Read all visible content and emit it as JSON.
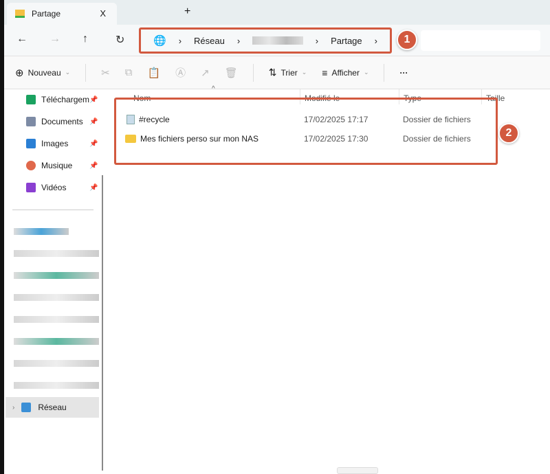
{
  "tab": {
    "title": "Partage",
    "close": "X",
    "new": "+"
  },
  "nav": {
    "back": "←",
    "forward": "→",
    "up": "↑",
    "refresh": "↻"
  },
  "breadcrumb": {
    "items": [
      "Réseau",
      "Partage"
    ],
    "sep": "›"
  },
  "badges": [
    "1",
    "2"
  ],
  "toolbar": {
    "new_label": "Nouveau",
    "sort_label": "Trier",
    "view_label": "Afficher",
    "more": "···"
  },
  "sidebar": {
    "items": [
      {
        "label": "Téléchargem",
        "color": "#1aa260"
      },
      {
        "label": "Documents",
        "color": "#7d8ba5"
      },
      {
        "label": "Images",
        "color": "#2a7fd4"
      },
      {
        "label": "Musique",
        "color": "#e0684b"
      },
      {
        "label": "Vidéos",
        "color": "#8a3fd1"
      }
    ],
    "network": "Réseau"
  },
  "columns": {
    "name": "Nom",
    "modified": "Modifié le",
    "type": "Type",
    "size": "Taille"
  },
  "files": [
    {
      "name": "#recycle",
      "modified": "17/02/2025 17:17",
      "type": "Dossier de fichiers"
    },
    {
      "name": "Mes fichiers perso sur mon NAS",
      "modified": "17/02/2025 17:30",
      "type": "Dossier de fichiers"
    }
  ],
  "accent": "#d2593f"
}
